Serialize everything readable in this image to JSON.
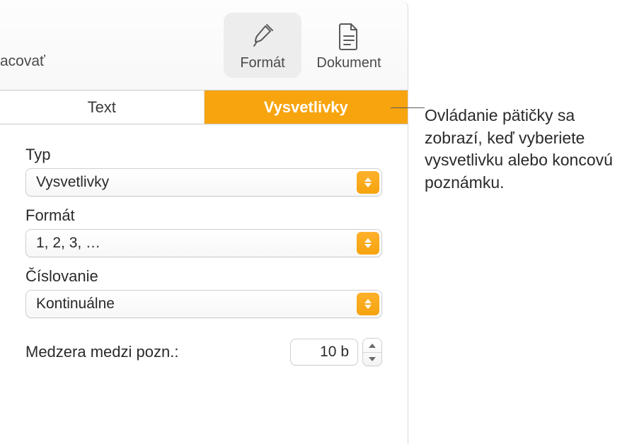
{
  "toolbar": {
    "left_text": "acovať",
    "format_label": "Formát",
    "document_label": "Dokument",
    "icons": {
      "format": "brush-icon",
      "document": "document-icon"
    }
  },
  "tabs": {
    "text": "Text",
    "footnotes": "Vysvetlivky"
  },
  "fields": {
    "type": {
      "label": "Typ",
      "value": "Vysvetlivky"
    },
    "format": {
      "label": "Formát",
      "value": "1, 2, 3, …"
    },
    "numbering": {
      "label": "Číslovanie",
      "value": "Kontinuálne"
    }
  },
  "spacing": {
    "label": "Medzera medzi pozn.:",
    "value": "10 b"
  },
  "callout": {
    "text": "Ovládanie pätičky sa zobrazí, keď vyberiete vysvetlivku alebo koncovú poznámku."
  }
}
